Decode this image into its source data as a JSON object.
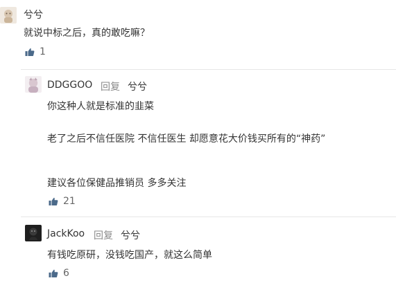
{
  "comments": {
    "c1": {
      "username": "兮兮",
      "lines": [
        "就说中标之后，真的敢吃嘛？"
      ],
      "likes": "1"
    },
    "c2": {
      "username": "DDGGOO",
      "reply_word": "回复",
      "reply_to": "兮兮",
      "lines": [
        "你这种人就是标准的韭菜",
        "老了之后不信任医院 不信任医生 却愿意花大价钱买所有的“神药”",
        "建议各位保健品推销员 多多关注"
      ],
      "likes": "21"
    },
    "c3": {
      "username": "JackKoo",
      "reply_word": "回复",
      "reply_to": "兮兮",
      "lines": [
        "有钱吃原研，没钱吃国产，就这么简单"
      ],
      "likes": "6"
    }
  },
  "colors": {
    "text": "#333333",
    "muted": "#8a8a8a",
    "like_icon": "#4b6a8a",
    "divider": "#e6e6e6"
  },
  "icons": {
    "like": "thumbs-up-icon"
  }
}
